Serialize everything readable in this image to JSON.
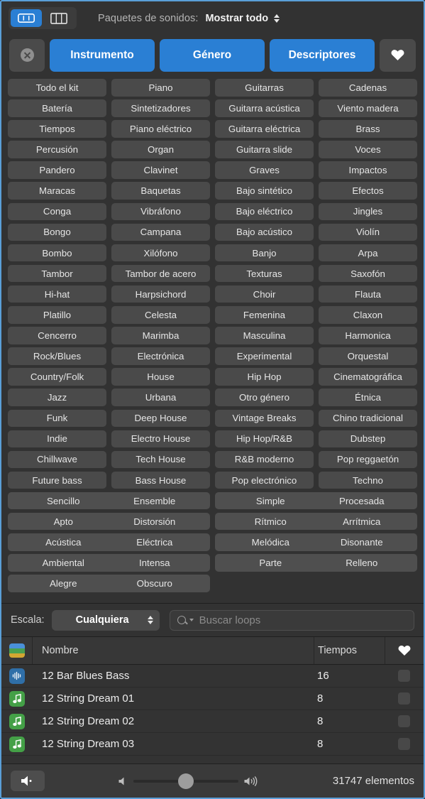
{
  "window": {
    "accent": "#2a7fd4",
    "border_color": "#5a9fd8"
  },
  "topbar": {
    "view_button_columns_icon": "column-view-icon",
    "view_button_grid_icon": "grid-view-icon",
    "packs_label": "Paquetes de sonidos:",
    "packs_value": "Mostrar todo",
    "stepper_icon": "up-down-stepper-icon"
  },
  "categories": {
    "clear_icon": "clear-circle-x-icon",
    "buttons": [
      "Instrumento",
      "Género",
      "Descriptores"
    ],
    "favorites_icon": "heart-icon"
  },
  "keyword_grid": {
    "rows": [
      {
        "type": "quad",
        "cells": [
          "Todo el kit",
          "Piano",
          "Guitarras",
          "Cadenas"
        ]
      },
      {
        "type": "quad",
        "cells": [
          "Batería",
          "Sintetizadores",
          "Guitarra acústica",
          "Viento madera"
        ]
      },
      {
        "type": "quad",
        "cells": [
          "Tiempos",
          "Piano eléctrico",
          "Guitarra eléctrica",
          "Brass"
        ]
      },
      {
        "type": "quad",
        "cells": [
          "Percusión",
          "Organ",
          "Guitarra slide",
          "Voces"
        ]
      },
      {
        "type": "quad",
        "cells": [
          "Pandero",
          "Clavinet",
          "Graves",
          "Impactos"
        ]
      },
      {
        "type": "quad",
        "cells": [
          "Maracas",
          "Baquetas",
          "Bajo sintético",
          "Efectos"
        ]
      },
      {
        "type": "quad",
        "cells": [
          "Conga",
          "Vibráfono",
          "Bajo eléctrico",
          "Jingles"
        ]
      },
      {
        "type": "quad",
        "cells": [
          "Bongo",
          "Campana",
          "Bajo acústico",
          "Violín"
        ]
      },
      {
        "type": "quad",
        "cells": [
          "Bombo",
          "Xilófono",
          "Banjo",
          "Arpa"
        ]
      },
      {
        "type": "quad",
        "cells": [
          "Tambor",
          "Tambor de acero",
          "Texturas",
          "Saxofón"
        ]
      },
      {
        "type": "quad",
        "cells": [
          "Hi-hat",
          "Harpsichord",
          "Choir",
          "Flauta"
        ]
      },
      {
        "type": "quad",
        "cells": [
          "Platillo",
          "Celesta",
          "Femenina",
          "Claxon"
        ]
      },
      {
        "type": "quad",
        "cells": [
          "Cencerro",
          "Marimba",
          "Masculina",
          "Harmonica"
        ]
      },
      {
        "type": "quad",
        "cells": [
          "Rock/Blues",
          "Electrónica",
          "Experimental",
          "Orquestal"
        ]
      },
      {
        "type": "quad",
        "cells": [
          "Country/Folk",
          "House",
          "Hip Hop",
          "Cinematográfica"
        ]
      },
      {
        "type": "quad",
        "cells": [
          "Jazz",
          "Urbana",
          "Otro género",
          "Étnica"
        ]
      },
      {
        "type": "quad",
        "cells": [
          "Funk",
          "Deep House",
          "Vintage Breaks",
          "Chino tradicional"
        ]
      },
      {
        "type": "quad",
        "cells": [
          "Indie",
          "Electro House",
          "Hip Hop/R&B",
          "Dubstep"
        ]
      },
      {
        "type": "quad",
        "cells": [
          "Chillwave",
          "Tech House",
          "R&B moderno",
          "Pop reggaetón"
        ]
      },
      {
        "type": "quad",
        "cells": [
          "Future bass",
          "Bass House",
          "Pop electrónico",
          "Techno"
        ]
      },
      {
        "type": "pair",
        "cells": [
          [
            "Sencillo",
            "Ensemble"
          ],
          [
            "Simple",
            "Procesada"
          ]
        ]
      },
      {
        "type": "pair",
        "cells": [
          [
            "Apto",
            "Distorsión"
          ],
          [
            "Rítmico",
            "Arrítmica"
          ]
        ]
      },
      {
        "type": "pair",
        "cells": [
          [
            "Acústica",
            "Eléctrica"
          ],
          [
            "Melódica",
            "Disonante"
          ]
        ]
      },
      {
        "type": "pair",
        "cells": [
          [
            "Ambiental",
            "Intensa"
          ],
          [
            "Parte",
            "Relleno"
          ]
        ]
      },
      {
        "type": "pair_half",
        "cells": [
          [
            "Alegre",
            "Obscuro"
          ]
        ]
      }
    ]
  },
  "scalebar": {
    "scale_label": "Escala:",
    "scale_value": "Cualquiera",
    "search_icon": "search-magnifier-icon",
    "search_value": "",
    "search_placeholder": "Buscar loops"
  },
  "table": {
    "header_icon": "color-stripe-icon",
    "columns": {
      "name": "Nombre",
      "beats": "Tiempos",
      "favorite_icon": "heart-icon"
    },
    "rows": [
      {
        "kind": "audio",
        "icon": "waveform-icon",
        "name": "12 Bar Blues Bass",
        "beats": "16"
      },
      {
        "kind": "midi",
        "icon": "music-note-icon",
        "name": "12 String Dream 01",
        "beats": "8"
      },
      {
        "kind": "midi",
        "icon": "music-note-icon",
        "name": "12 String Dream 02",
        "beats": "8"
      },
      {
        "kind": "midi",
        "icon": "music-note-icon",
        "name": "12 String Dream 03",
        "beats": "8"
      }
    ]
  },
  "footer": {
    "speaker_button_icon": "speaker-icon",
    "volume_low_icon": "volume-low-icon",
    "volume_high_icon": "volume-high-icon",
    "volume_percent": 50,
    "item_count": "31747 elementos"
  }
}
